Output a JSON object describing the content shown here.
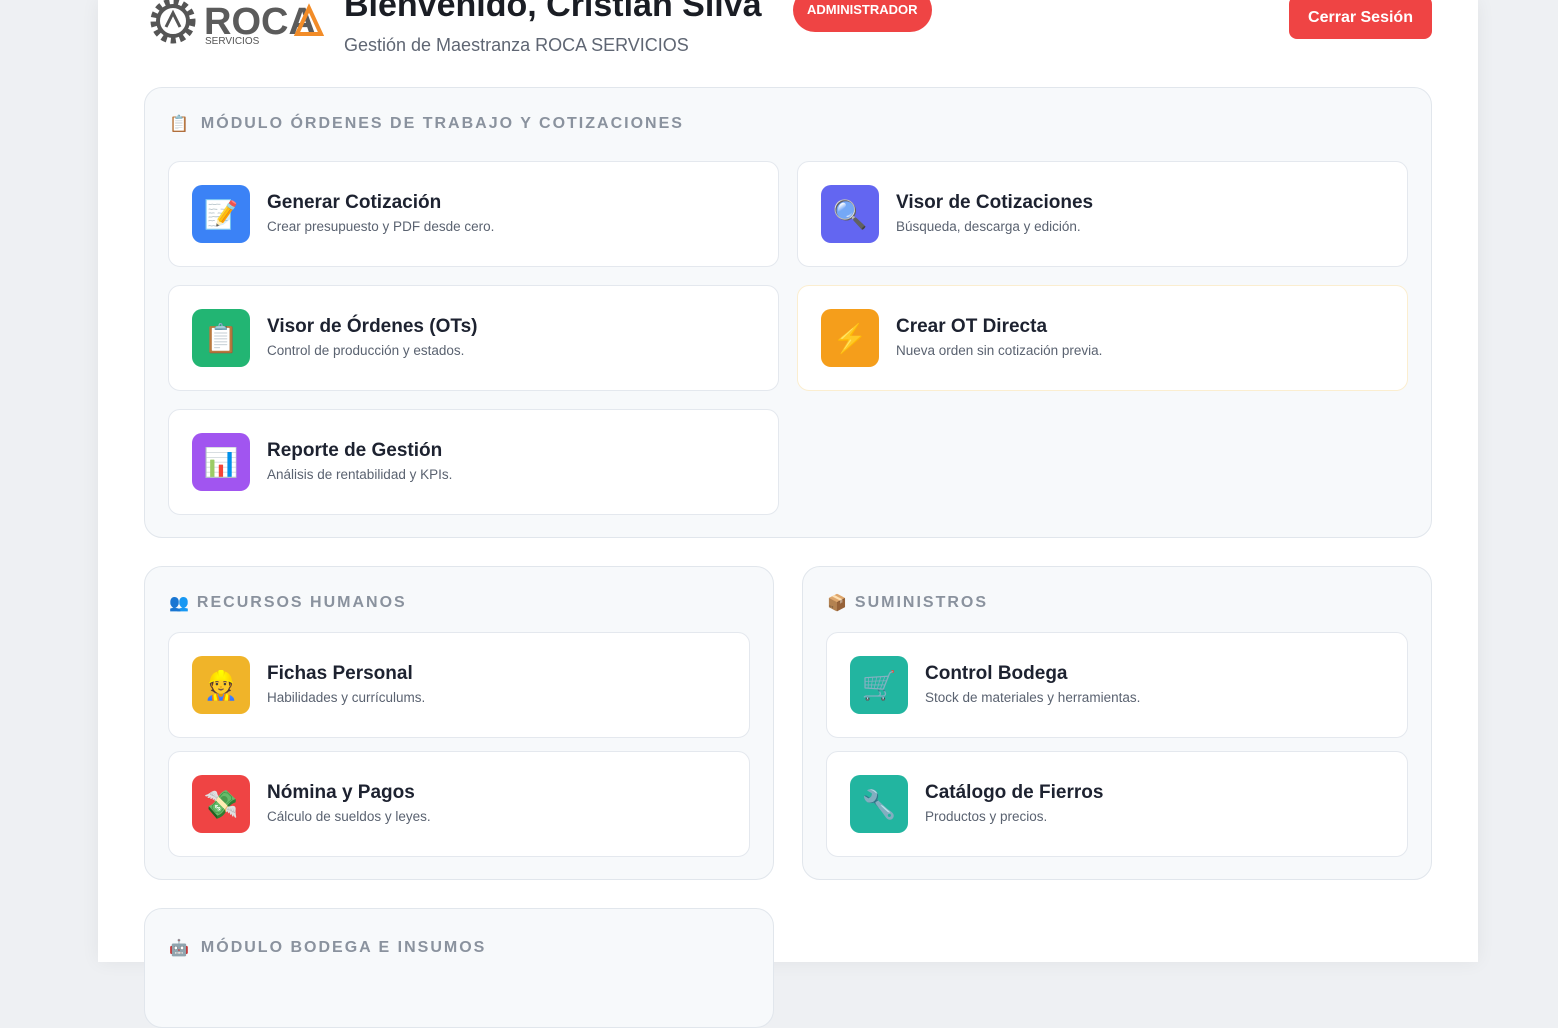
{
  "header": {
    "logo_text": "ROCA",
    "logo_sub": "SERVICIOS",
    "welcome": "Bienvenido, Cristian Silva",
    "subtitle": "Gestión de Maestranza ROCA SERVICIOS",
    "role_badge": "ADMINISTRADOR",
    "logout_label": "Cerrar Sesión"
  },
  "sections": {
    "ordenes": {
      "icon": "📋",
      "title": "MÓDULO ÓRDENES DE TRABAJO Y COTIZACIONES",
      "cards": [
        {
          "icon": "📝",
          "title": "Generar Cotización",
          "desc": "Crear presupuesto y PDF desde cero.",
          "color": "#3b82f6"
        },
        {
          "icon": "🔍",
          "title": "Visor de Cotizaciones",
          "desc": "Búsqueda, descarga y edición.",
          "color": "#6366f1"
        },
        {
          "icon": "📋",
          "title": "Visor de Órdenes (OTs)",
          "desc": "Control de producción y estados.",
          "color": "#22b573"
        },
        {
          "icon": "⚡",
          "title": "Crear OT Directa",
          "desc": "Nueva orden sin cotización previa.",
          "color": "#f59e1b"
        },
        {
          "icon": "📊",
          "title": "Reporte de Gestión",
          "desc": "Análisis de rentabilidad y KPIs.",
          "color": "#a155f0"
        }
      ]
    },
    "rrhh": {
      "icon": "👥",
      "title": "RECURSOS HUMANOS",
      "cards": [
        {
          "icon": "👷",
          "title": "Fichas Personal",
          "desc": "Habilidades y currículums.",
          "color": "#f0b429"
        },
        {
          "icon": "💸",
          "title": "Nómina y Pagos",
          "desc": "Cálculo de sueldos y leyes.",
          "color": "#ef4444"
        }
      ]
    },
    "suministros": {
      "icon": "📦",
      "title": "SUMINISTROS",
      "cards": [
        {
          "icon": "🛒",
          "title": "Control Bodega",
          "desc": "Stock de materiales y herramientas.",
          "color": "#22b5a0"
        },
        {
          "icon": "🔧",
          "title": "Catálogo de Fierros",
          "desc": "Productos y precios.",
          "color": "#22b5a0"
        }
      ]
    },
    "bodega": {
      "icon": "🤖",
      "title": "MÓDULO BODEGA E INSUMOS"
    }
  },
  "colors": {
    "accent_red": "#ef4444",
    "page_bg": "#eef0f3",
    "section_bg": "#f7f9fb"
  }
}
